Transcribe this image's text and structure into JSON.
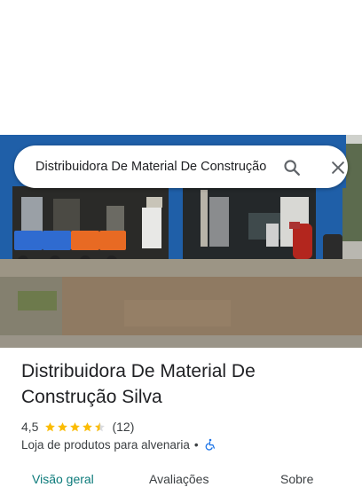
{
  "search": {
    "query": "Distribuidora De Material De Construção Silva",
    "search_icon": "search-icon",
    "close_icon": "close-icon"
  },
  "place": {
    "name": "Distribuidora De Material De Construção Silva",
    "rating": "4,5",
    "rating_value": 4.5,
    "review_count": "(12)",
    "category": "Loja de produtos para alvenaria",
    "separator": "•",
    "accessibility_icon": "wheelchair-icon"
  },
  "tabs": [
    {
      "label": "Visão geral",
      "active": true
    },
    {
      "label": "Avaliações",
      "active": false
    },
    {
      "label": "Sobre",
      "active": false
    }
  ],
  "colors": {
    "star": "#fbbc04",
    "active_tab": "#0b7a7a",
    "accessibility_icon": "#1a73e8",
    "storefront_blue": "#1f5fa8"
  }
}
